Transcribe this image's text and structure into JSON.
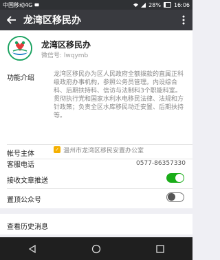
{
  "status_bar": {
    "carrier": "中国移动4G",
    "battery": "28%",
    "time": "16:06"
  },
  "header": {
    "title": "龙湾区移民办"
  },
  "profile": {
    "name": "龙湾区移民办",
    "wechat_id": "微信号: lwqymb"
  },
  "info": {
    "intro_label": "功能介绍",
    "intro_text": "龙湾区移民办为区人民政府全额拨款的直属正科级政府办事机构，参照公务员管理。内设综合科、后期扶持科、信访与法制科3个职能科室。贯彻执行党和国家水利水电移民法律、法规和方针政策；负责全区水库移民动迁安置、后期扶持等。",
    "owner_label": "帐号主体",
    "owner_value": "温州市龙湾区移民安置办公室",
    "phone_label": "客服电话",
    "phone_value": "0577-86357330"
  },
  "settings": {
    "receive_label": "接收文章推送",
    "receive_on": true,
    "pin_label": "置顶公众号",
    "pin_on": false
  },
  "history": {
    "label": "查看历史消息"
  },
  "colors": {
    "header": "#393a3f",
    "toggle_on": "#1aad19",
    "verify": "#f5b000"
  }
}
